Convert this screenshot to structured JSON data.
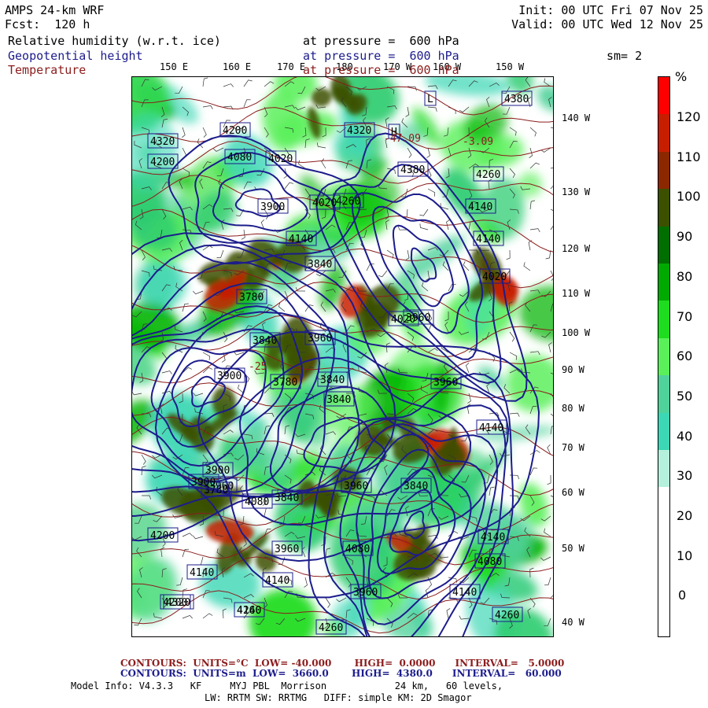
{
  "header": {
    "title": "AMPS 24-km WRF",
    "forecast": "Fcst:  120 h",
    "init": "Init: 00 UTC Fri 07 Nov 25",
    "valid": "Valid: 00 UTC Wed 12 Nov 25",
    "sm": "sm= 2"
  },
  "fields": [
    {
      "name": "Relative humidity (w.r.t. ice)",
      "level": "at pressure =  600 hPa",
      "color": "#000000"
    },
    {
      "name": "Geopotential height",
      "level": "at pressure =  600 hPa",
      "color": "#1c1c8c"
    },
    {
      "name": "Temperature",
      "level": "at pressure =  600 hPa",
      "color": "#8c1c1c"
    }
  ],
  "top_longitudes": [
    "150 E",
    "160 E",
    "170 E",
    "180",
    "170 W",
    "160 W",
    "150 W"
  ],
  "right_longitudes": [
    "140 W",
    "130 W",
    "120 W",
    "110 W",
    "100 W",
    "90 W",
    "80 W",
    "70 W",
    "60 W",
    "50 W",
    "40 W"
  ],
  "colorbar": {
    "unit": "%",
    "ticks": [
      "120",
      "110",
      "100",
      "90",
      "80",
      "70",
      "60",
      "50",
      "40",
      "30",
      "20",
      "10",
      "0"
    ],
    "bands": [
      {
        "color": "#ff0000"
      },
      {
        "color": "#c81e00"
      },
      {
        "color": "#8c2800"
      },
      {
        "color": "#3c5000"
      },
      {
        "color": "#006e00"
      },
      {
        "color": "#00aa00"
      },
      {
        "color": "#1edc1e"
      },
      {
        "color": "#5af05a"
      },
      {
        "color": "#50d29b"
      },
      {
        "color": "#3cd7b4"
      },
      {
        "color": "#b4f0dc"
      },
      {
        "color": "#ffffff"
      },
      {
        "color": "#ffffff"
      },
      {
        "color": "#ffffff"
      },
      {
        "color": "#ffffff"
      }
    ]
  },
  "height_labels": [
    "L",
    "H",
    "4320",
    "4200",
    "4320",
    "4380",
    "4260",
    "4080",
    "4020",
    "3900",
    "4020",
    "4140",
    "3840",
    "4260",
    "4140",
    "4020",
    "4140",
    "3780",
    "3960",
    "4020",
    "3840",
    "3960",
    "3840",
    "3900",
    "3900",
    "3960",
    "3780",
    "3960",
    "3840",
    "3780",
    "3960",
    "3840",
    "3900",
    "3840",
    "4140",
    "4080",
    "4140",
    "4200",
    "4080",
    "3960",
    "4140",
    "4140",
    "4080",
    "3960",
    "4140",
    "4200",
    "4260",
    "4140",
    "4320",
    "4200",
    "4380",
    "4260",
    "4260"
  ],
  "temp_labels": [
    "-47.09",
    "-3.09",
    "-25"
  ],
  "footer": {
    "temp_contours": "CONTOURS:  UNITS=°C  LOW= -40.000       HIGH=  0.0000      INTERVAL=   5.0000",
    "height_contours": "CONTOURS:  UNITS=m  LOW=  3660.0       HIGH=  4380.0      INTERVAL=   60.000",
    "model_info": "Model Info: V4.3.3   KF     MYJ PBL  Morrison            24 km,   60 levels,",
    "model_info2": "LW: RRTM SW: RRTMG   DIFF: simple KM: 2D Smagor"
  }
}
